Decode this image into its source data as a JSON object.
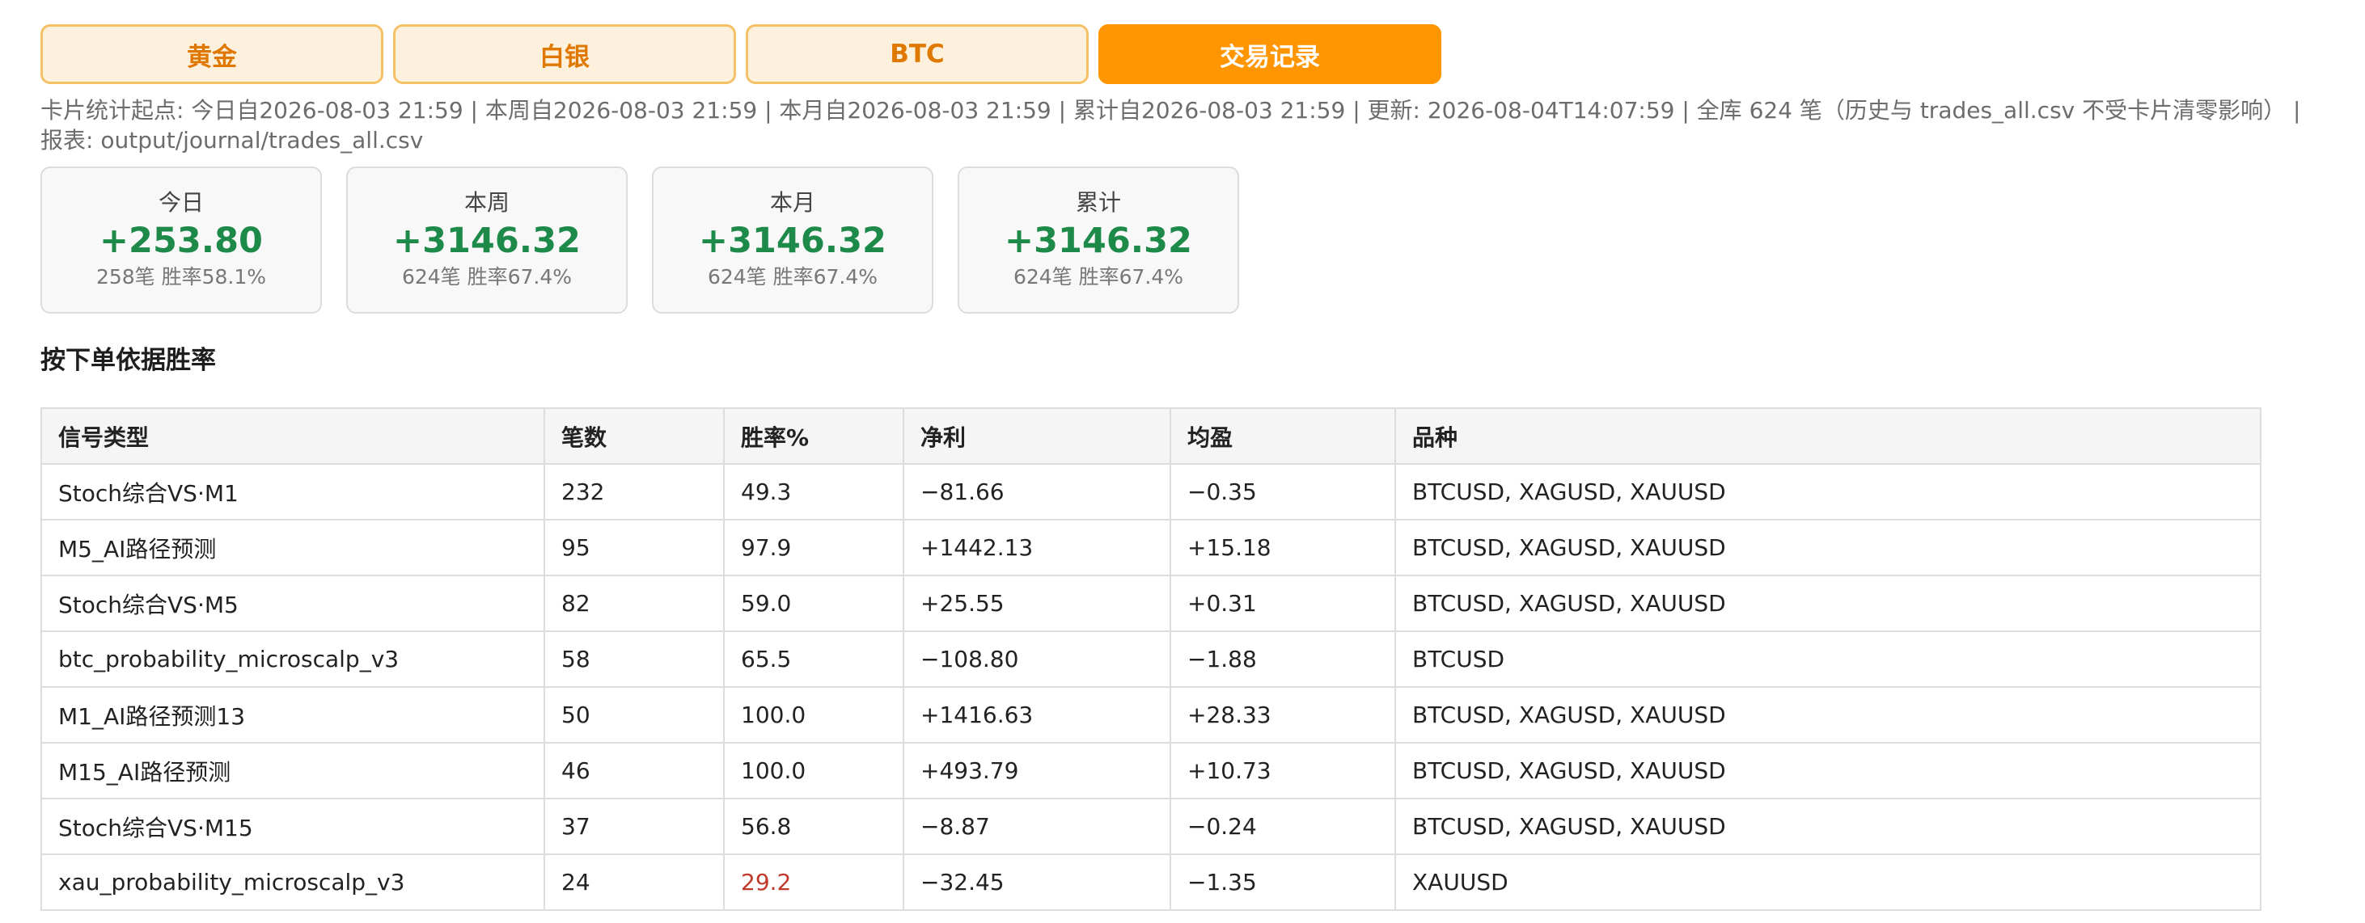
{
  "tabs": [
    {
      "label": "黄金",
      "active": false
    },
    {
      "label": "白银",
      "active": false
    },
    {
      "label": "BTC",
      "active": false
    },
    {
      "label": "交易记录",
      "active": true
    }
  ],
  "meta_text": "卡片统计起点: 今日自2026-08-03 21:59 | 本周自2026-08-03 21:59 | 本月自2026-08-03 21:59 | 累计自2026-08-03 21:59 | 更新: 2026-08-04T14:07:59 | 全库 624 笔（历史与 trades_all.csv 不受卡片清零影响） | 报表: output/journal/trades_all.csv",
  "cards": [
    {
      "label": "今日",
      "value": "+253.80",
      "sub": "258笔 胜率58.1%"
    },
    {
      "label": "本周",
      "value": "+3146.32",
      "sub": "624笔 胜率67.4%"
    },
    {
      "label": "本月",
      "value": "+3146.32",
      "sub": "624笔 胜率67.4%"
    },
    {
      "label": "累计",
      "value": "+3146.32",
      "sub": "624笔 胜率67.4%"
    }
  ],
  "section_title": "按下单依据胜率",
  "table": {
    "headers": [
      "信号类型",
      "笔数",
      "胜率%",
      "净利",
      "均盈",
      "品种"
    ],
    "rows": [
      [
        "Stoch综合VS·M1",
        "232",
        "49.3",
        "−81.66",
        "−0.35",
        "BTCUSD, XAGUSD, XAUUSD"
      ],
      [
        "M5_AI路径预测",
        "95",
        "97.9",
        "+1442.13",
        "+15.18",
        "BTCUSD, XAGUSD, XAUUSD"
      ],
      [
        "Stoch综合VS·M5",
        "82",
        "59.0",
        "+25.55",
        "+0.31",
        "BTCUSD, XAGUSD, XAUUSD"
      ],
      [
        "btc_probability_microscalp_v3",
        "58",
        "65.5",
        "−108.80",
        "−1.88",
        "BTCUSD"
      ],
      [
        "M1_AI路径预测13",
        "50",
        "100.0",
        "+1416.63",
        "+28.33",
        "BTCUSD, XAGUSD, XAUUSD"
      ],
      [
        "M15_AI路径预测",
        "46",
        "100.0",
        "+493.79",
        "+10.73",
        "BTCUSD, XAGUSD, XAUUSD"
      ],
      [
        "Stoch综合VS·M15",
        "37",
        "56.8",
        "−8.87",
        "−0.24",
        "BTCUSD, XAGUSD, XAUUSD"
      ],
      [
        "xau_probability_microscalp_v3",
        "24",
        "29.2",
        "−32.45",
        "−1.35",
        "XAUUSD"
      ]
    ]
  },
  "colors": {
    "accent": "#ff9500",
    "positive": "#1e8a4a",
    "low_winrate": "#c0392b"
  }
}
